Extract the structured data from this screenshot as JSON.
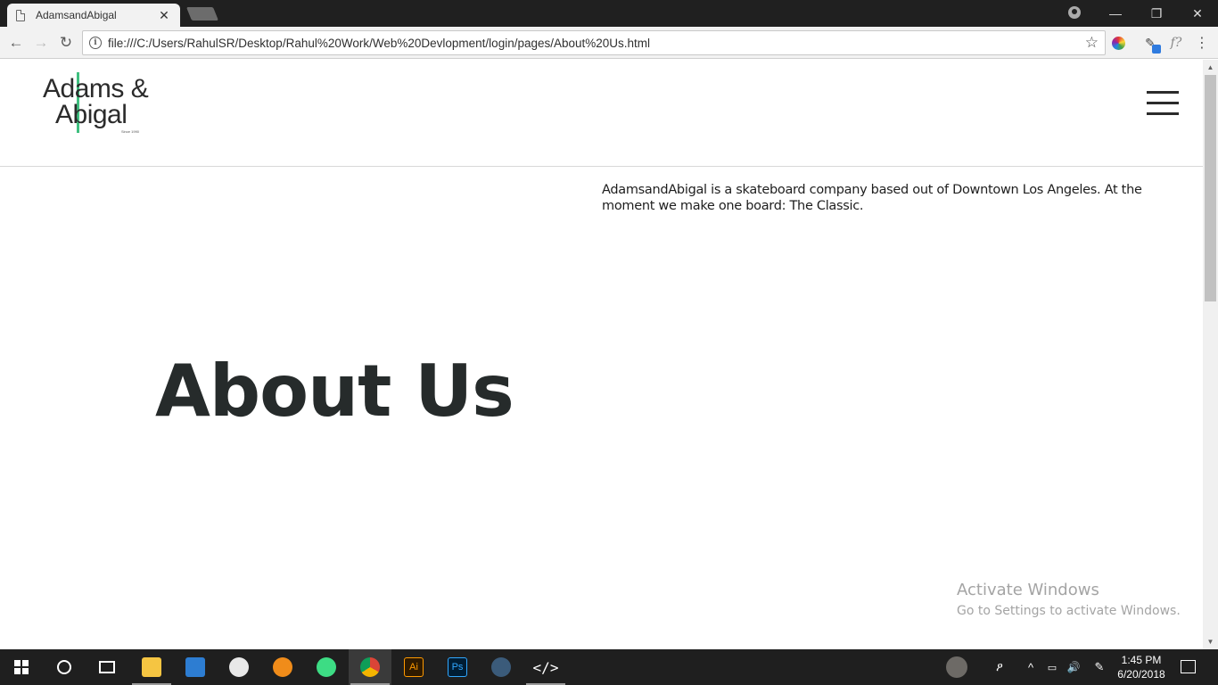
{
  "browser": {
    "tab_title": "AdamsandAbigal",
    "tab_close": "✕",
    "url": "file:///C:/Users/RahulSR/Desktop/Rahul%20Work/Web%20Devlopment/login/pages/About%20Us.html",
    "window_controls": {
      "minimize": "—",
      "restore": "❐",
      "close": "✕"
    },
    "nav": {
      "back": "←",
      "forward": "→",
      "reload": "↻"
    },
    "icons": {
      "info": "i",
      "star": "☆",
      "font_ext": "f?",
      "menu": "⋮"
    }
  },
  "site": {
    "logo": {
      "line1": "Adams &",
      "line2": "Abigal",
      "since": "Since 1990",
      "accent_color": "#3fbf7f"
    },
    "description": "AdamsandAbigal is a skateboard company based out of Downtown Los Angeles. At the moment we make one board: The Classic.",
    "heading": "About Us"
  },
  "watermark": {
    "title": "Activate Windows",
    "subtitle": "Go to Settings to activate Windows."
  },
  "scrollbar": {
    "up": "▲",
    "down": "▼"
  },
  "taskbar": {
    "apps": [
      {
        "name": "file-explorer",
        "color": "#f5c542"
      },
      {
        "name": "store",
        "color": "#2d7dd2"
      },
      {
        "name": "itunes",
        "color": "#e8e8e8"
      },
      {
        "name": "blender",
        "color": "#f08c1a"
      },
      {
        "name": "android-studio",
        "color": "#3ddc84"
      },
      {
        "name": "chrome",
        "color": "#4285f4"
      },
      {
        "name": "illustrator",
        "color": "#ff9a00"
      },
      {
        "name": "photoshop",
        "color": "#31a8ff"
      },
      {
        "name": "steam",
        "color": "#1b2838"
      },
      {
        "name": "code-editor",
        "color": "#ffffff"
      }
    ],
    "labels": {
      "illustrator": "Ai",
      "photoshop": "Ps"
    },
    "tray": {
      "chevron": "^",
      "volume": "🔊",
      "pen": "✎",
      "people": "ዖ"
    },
    "time": "1:45 PM",
    "date": "6/20/2018"
  }
}
